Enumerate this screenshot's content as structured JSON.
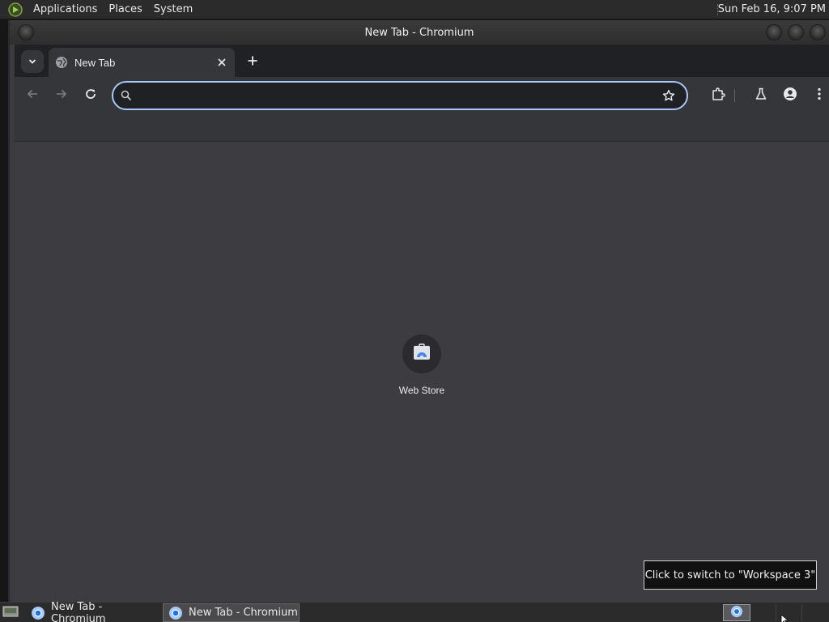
{
  "top_panel": {
    "menus": [
      "Applications",
      "Places",
      "System"
    ],
    "clock": "Sun Feb 16,  9:07 PM"
  },
  "window": {
    "title": "New Tab - Chromium"
  },
  "browser": {
    "tab": {
      "title": "New Tab"
    },
    "omnibox": {
      "value": "",
      "placeholder": ""
    },
    "shortcuts": [
      {
        "label": "Web Store"
      }
    ]
  },
  "tooltip": {
    "text": "Click to switch to \"Workspace 3\""
  },
  "taskbar": {
    "items": [
      {
        "label": "New Tab - Chromium",
        "active": false
      },
      {
        "label": "New Tab - Chromium",
        "active": true
      }
    ]
  },
  "colors": {
    "accent_focus_ring": "#a8c7fa",
    "tab_strip": "#202124",
    "toolbar": "#35363a",
    "content_bg": "#3c3c41",
    "panel_bg": "#2b2b2b"
  },
  "icons": {
    "panel_logo": "mint-logo-icon",
    "tab_favicon": "globe-icon",
    "back": "arrow-left-icon",
    "forward": "arrow-right-icon",
    "reload": "reload-icon",
    "search": "search-icon",
    "bookmark": "star-icon",
    "extensions": "puzzle-icon",
    "labs": "flask-icon",
    "profile": "account-icon",
    "menu": "kebab-menu-icon",
    "web_store": "web-store-icon"
  }
}
